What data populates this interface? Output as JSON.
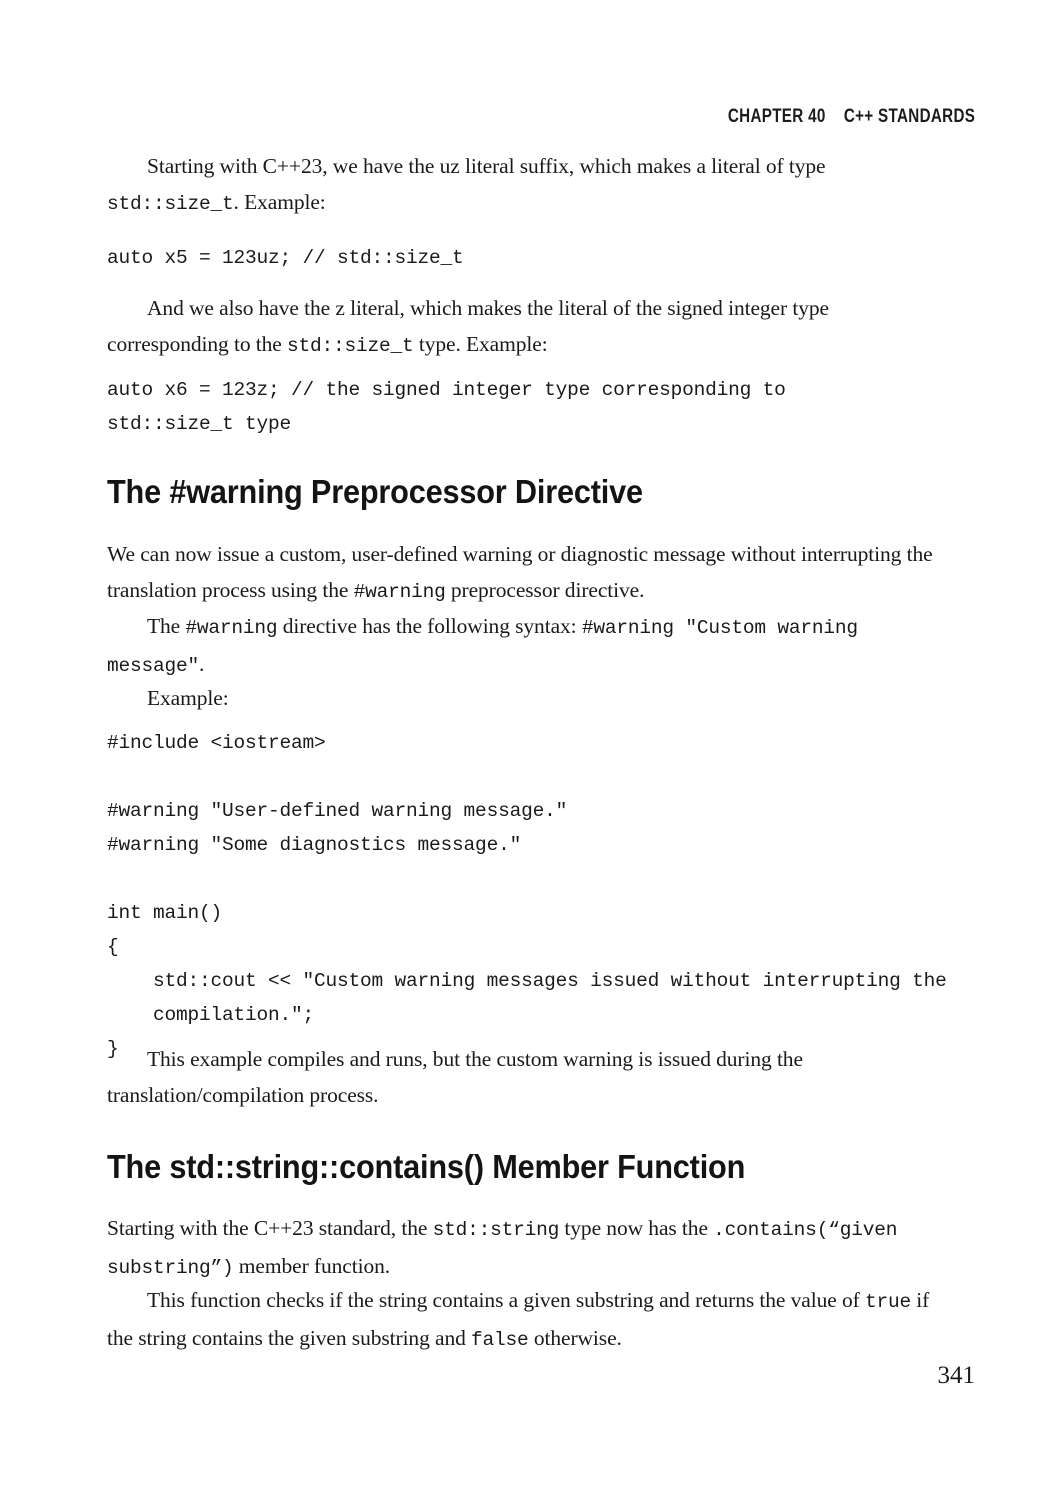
{
  "page": {
    "running_head": "CHAPTER 40    C++ STANDARDS",
    "folio": "341"
  },
  "para1": {
    "seg_a": "Starting with C++23, we have the uz literal suffix, which makes a literal of type ",
    "code_a": "std::size_t",
    "seg_b": ". Example:"
  },
  "code1": "auto x5 = 123uz; // std::size_t",
  "para2": {
    "seg_a": "And we also have the z literal, which makes the literal of the signed integer type corresponding to the ",
    "code_a": "std::size_t",
    "seg_b": " type. Example:"
  },
  "code2": "auto x6 = 123z; // the signed integer type corresponding to\nstd::size_t type",
  "heading1": "The #warning Preprocessor Directive",
  "para3": {
    "seg_a": "We can now issue a custom, user-defined warning or diagnostic message without interrupting the translation process using the ",
    "code_a": "#warning",
    "seg_b": " preprocessor directive."
  },
  "para4": {
    "seg_a": "The ",
    "code_a": "#warning",
    "seg_b": " directive has the following syntax: ",
    "code_b": "#warning \"Custom warning message\"",
    "seg_c": "."
  },
  "para5": {
    "text": "Example:"
  },
  "code3": "#include <iostream>\n\n#warning \"User-defined warning message.\"\n#warning \"Some diagnostics message.\"\n\nint main()\n{\n    std::cout << \"Custom warning messages issued without interrupting the\n    compilation.\";\n}",
  "para6": {
    "text": "This example compiles and runs, but the custom warning is issued during the translation/compilation process."
  },
  "heading2": "The std::string::contains() Member Function",
  "para7": {
    "seg_a": "Starting with the C++23 standard, the ",
    "code_a": "std::string",
    "seg_b": " type now has the ",
    "code_b": ".contains(“given substring”)",
    "seg_c": " member function."
  },
  "para8": {
    "seg_a": "This function checks if the string contains a given substring and returns the value of ",
    "code_a": "true",
    "seg_b": " if the string contains the given substring and ",
    "code_b": "false",
    "seg_c": " otherwise."
  }
}
